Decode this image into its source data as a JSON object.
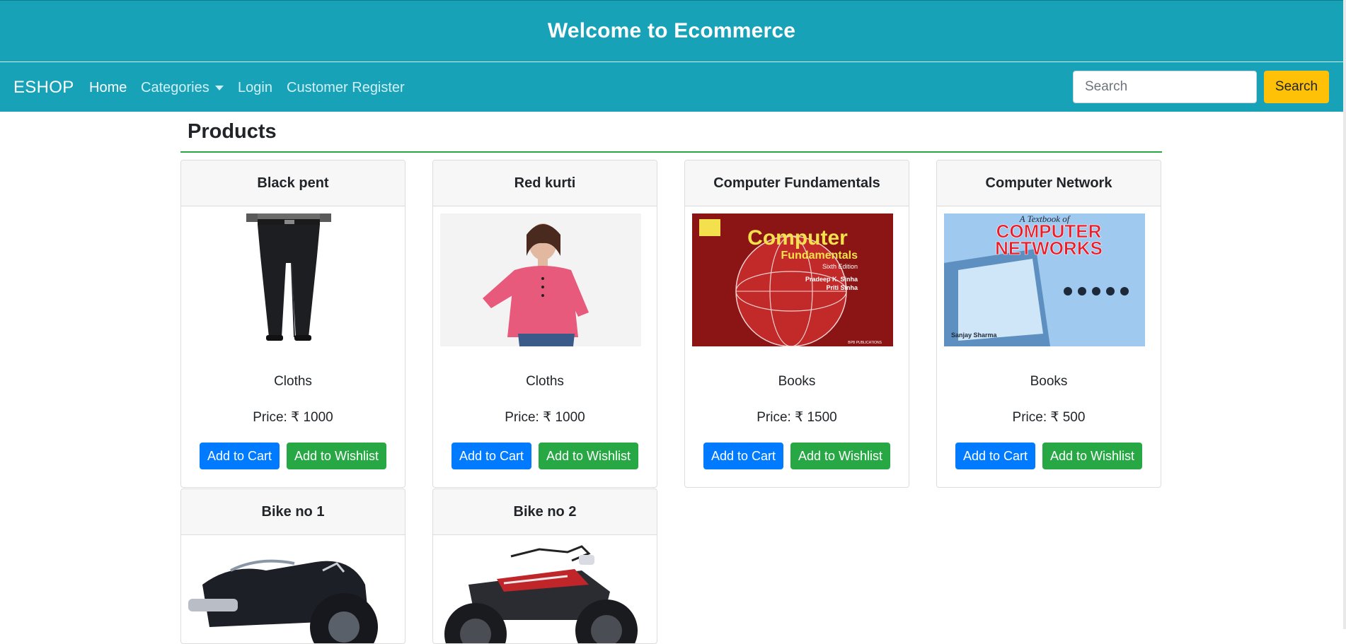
{
  "banner": {
    "title": "Welcome to Ecommerce"
  },
  "nav": {
    "brand": "ESHOP",
    "links": [
      "Home",
      "Categories",
      "Login",
      "Customer Register"
    ],
    "search_placeholder": "Search",
    "search_button": "Search"
  },
  "main": {
    "section_title": "Products"
  },
  "products": [
    {
      "name": "Black pent",
      "category": "Cloths",
      "price": "Price: ₹ 1000",
      "cart": "Add to Cart",
      "wishlist": "Add to Wishlist"
    },
    {
      "name": "Red kurti",
      "category": "Cloths",
      "price": "Price: ₹ 1000",
      "cart": "Add to Cart",
      "wishlist": "Add to Wishlist"
    },
    {
      "name": "Computer Fundamentals",
      "category": "Books",
      "price": "Price: ₹ 1500",
      "cart": "Add to Cart",
      "wishlist": "Add to Wishlist"
    },
    {
      "name": "Computer Network",
      "category": "Books",
      "price": "Price: ₹ 500",
      "cart": "Add to Cart",
      "wishlist": "Add to Wishlist"
    },
    {
      "name": "Bike no 1"
    },
    {
      "name": "Bike no 2"
    }
  ],
  "images": {
    "book1": {
      "title": "Computer",
      "subtitle": "Fundamentals",
      "edition": "Sixth Edition",
      "author1": "Pradeep K. Sinha",
      "author2": "Priti Sinha",
      "publisher": "BPB PUBLICATIONS"
    },
    "book2": {
      "top": "A Textbook of",
      "title1": "COMPUTER",
      "title2": "NETWORKS",
      "author": "Sanjay Sharma"
    }
  },
  "colors": {
    "primary": "#17a2b8",
    "cart": "#007bff",
    "wishlist": "#28a745",
    "search": "#ffc107"
  }
}
